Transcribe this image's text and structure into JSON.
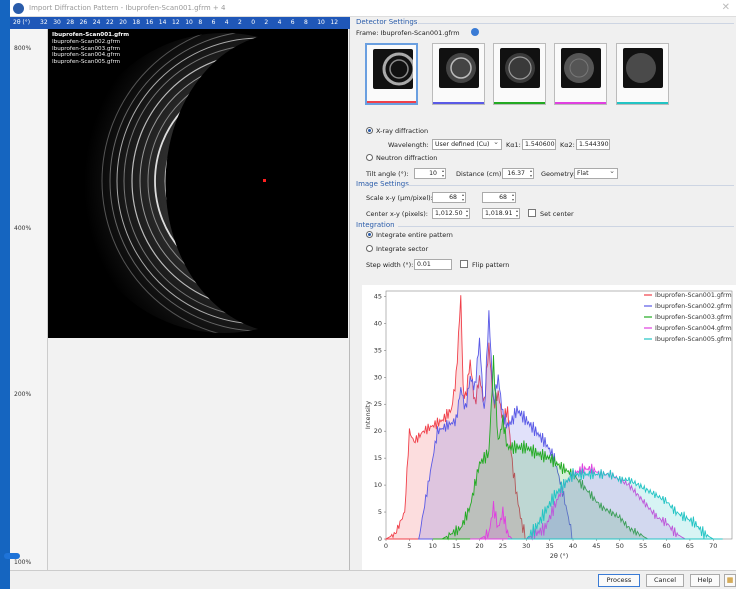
{
  "window": {
    "title": "Import Diffraction Pattern - Ibuprofen-Scan001.gfrm + 4"
  },
  "ruler": {
    "unit_label": "2θ (°)",
    "ticks": [
      "32",
      "30",
      "28",
      "26",
      "24",
      "22",
      "20",
      "18",
      "16",
      "14",
      "12",
      "10",
      "8",
      "6",
      "4",
      "2",
      "0",
      "2",
      "4",
      "6",
      "8",
      "10",
      "12"
    ]
  },
  "zoom": {
    "levels": [
      "800%",
      "400%",
      "200%",
      "100%"
    ],
    "current": "100%"
  },
  "files": [
    "Ibuprofen-Scan001.gfrm",
    "Ibuprofen-Scan002.gfrm",
    "Ibuprofen-Scan003.gfrm",
    "Ibuprofen-Scan004.gfrm",
    "Ibuprofen-Scan005.gfrm"
  ],
  "detector": {
    "section": "Detector Settings",
    "frame_label": "Frame: Ibuprofen-Scan001.gfrm",
    "xray_label": "X-ray diffraction",
    "wavelength_label": "Wavelength:",
    "wavelength_value": "User defined (Cu)",
    "ka1_label": "Kα1:",
    "ka1_value": "1.540600",
    "ka2_label": "Kα2:",
    "ka2_value": "1.544390",
    "neutron_label": "Neutron diffraction",
    "tilt_label": "Tilt angle (°):",
    "tilt_value": "10",
    "distance_label": "Distance (cm):",
    "distance_value": "16.37",
    "geometry_label": "Geometry:",
    "geometry_value": "Flat"
  },
  "image_settings": {
    "section": "Image Settings",
    "scale_label": "Scale x-y (µm/pixel):",
    "scale_x": "68",
    "scale_y": "68",
    "center_label": "Center x-y (pixels):",
    "center_x": "1,012.50",
    "center_y": "1,018.91",
    "set_center_label": "Set center"
  },
  "integration": {
    "section": "Integration",
    "entire_label": "Integrate entire pattern",
    "sector_label": "Integrate sector",
    "step_label": "Step width (°):",
    "step_value": "0.01",
    "flip_label": "Flip pattern"
  },
  "colors": {
    "s1": "#f0404a",
    "s2": "#5a5ae6",
    "s3": "#22aa22",
    "s4": "#e040e0",
    "s5": "#22c4c4"
  },
  "buttons": {
    "process": "Process",
    "cancel": "Cancel",
    "help": "Help"
  },
  "chart_data": {
    "type": "area",
    "xlabel": "2θ (°)",
    "ylabel": "Intensity",
    "xlim": [
      0,
      74
    ],
    "ylim": [
      0,
      46
    ],
    "xticks": [
      0,
      5,
      10,
      15,
      20,
      25,
      30,
      35,
      40,
      45,
      50,
      55,
      60,
      65,
      70
    ],
    "yticks": [
      0,
      5,
      10,
      15,
      20,
      25,
      30,
      35,
      40,
      45
    ],
    "legend_position": "top-right",
    "series": [
      {
        "name": "Ibuprofen-Scan001.gfrm",
        "x": [
          0,
          2,
          4,
          5,
          6,
          7,
          8,
          10,
          12,
          14,
          15,
          16,
          16.5,
          17,
          18,
          19,
          20,
          21,
          22,
          23,
          24,
          25,
          26,
          27,
          28,
          29,
          30
        ],
        "y": [
          0,
          1,
          5,
          20,
          18,
          19,
          20,
          21,
          22,
          24,
          30,
          45,
          28,
          26,
          33,
          25,
          30,
          25,
          36,
          25,
          27,
          22,
          24,
          14,
          8,
          3,
          0
        ]
      },
      {
        "name": "Ibuprofen-Scan002.gfrm",
        "x": [
          7,
          9,
          11,
          13,
          15,
          16,
          17,
          18,
          19,
          20,
          21,
          22,
          23,
          24,
          25,
          26,
          27,
          28,
          30,
          32,
          34,
          36,
          38,
          40
        ],
        "y": [
          0,
          10,
          20,
          21,
          22,
          28,
          24,
          30,
          28,
          37,
          23,
          42,
          25,
          30,
          23,
          21,
          22,
          24,
          22,
          20,
          18,
          15,
          8,
          0
        ]
      },
      {
        "name": "Ibuprofen-Scan003.gfrm",
        "x": [
          10,
          12,
          14,
          16,
          18,
          20,
          22,
          23,
          24,
          25,
          26,
          28,
          30,
          32,
          35,
          38,
          40,
          42,
          44,
          46,
          48,
          50,
          52,
          54,
          56
        ],
        "y": [
          0,
          0,
          1,
          2,
          6,
          14,
          16,
          33,
          18,
          22,
          17,
          17,
          17,
          16,
          15,
          13,
          12,
          10,
          8,
          6,
          5,
          4,
          2,
          1,
          0
        ]
      },
      {
        "name": "Ibuprofen-Scan004.gfrm",
        "x": [
          18,
          20,
          22,
          23,
          24,
          25,
          26,
          27,
          28,
          30,
          32,
          34,
          36,
          38,
          40,
          42,
          44,
          46,
          48,
          50,
          52,
          54,
          56,
          58,
          60,
          62,
          64
        ],
        "y": [
          0,
          0,
          1,
          6,
          2,
          5,
          1,
          0,
          0,
          0,
          1,
          2,
          6,
          10,
          12,
          13,
          13,
          12,
          12,
          11,
          10,
          8,
          6,
          4,
          3,
          1,
          0
        ]
      },
      {
        "name": "Ibuprofen-Scan005.gfrm",
        "x": [
          26,
          28,
          30,
          32,
          34,
          36,
          38,
          40,
          42,
          44,
          46,
          48,
          50,
          52,
          54,
          56,
          58,
          60,
          62,
          64,
          66,
          68,
          70,
          72
        ],
        "y": [
          0,
          0,
          0,
          2,
          5,
          8,
          10,
          12,
          12,
          12,
          12,
          12,
          11,
          11,
          10,
          9,
          8,
          7,
          5,
          4,
          3,
          1,
          0,
          0
        ]
      }
    ]
  }
}
